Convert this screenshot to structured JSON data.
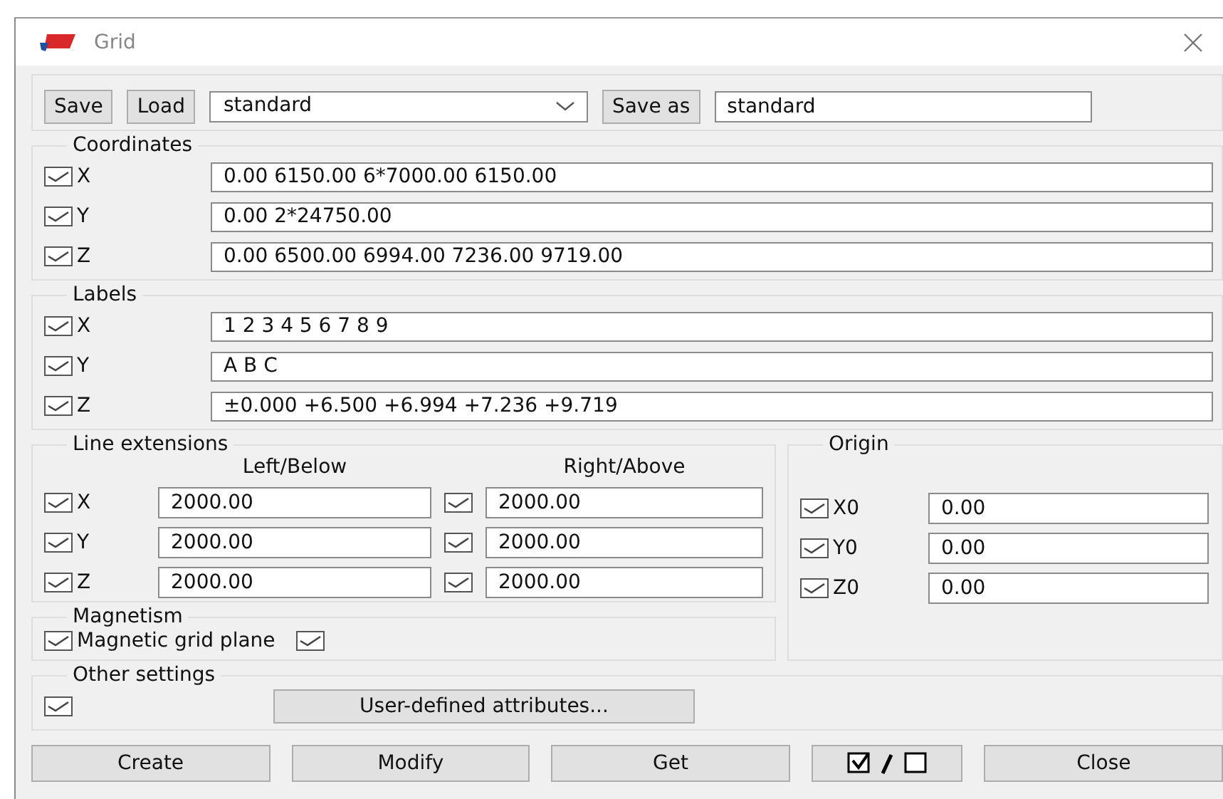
{
  "window": {
    "title": "Grid"
  },
  "toolbar": {
    "save": "Save",
    "load": "Load",
    "attribute_file": "standard",
    "save_as": "Save as",
    "save_as_name": "standard"
  },
  "coordinates": {
    "title": "Coordinates",
    "rows": [
      {
        "axis": "X",
        "checked": true,
        "value": "0.00 6150.00 6*7000.00 6150.00"
      },
      {
        "axis": "Y",
        "checked": true,
        "value": "0.00 2*24750.00"
      },
      {
        "axis": "Z",
        "checked": true,
        "value": "0.00 6500.00 6994.00 7236.00 9719.00"
      }
    ]
  },
  "labels": {
    "title": "Labels",
    "rows": [
      {
        "axis": "X",
        "checked": true,
        "value": "1 2 3 4 5 6 7 8 9"
      },
      {
        "axis": "Y",
        "checked": true,
        "value": "A B C"
      },
      {
        "axis": "Z",
        "checked": true,
        "value": "±0.000 +6.500 +6.994 +7.236 +9.719"
      }
    ]
  },
  "line_extensions": {
    "title": "Line extensions",
    "left_header": "Left/Below",
    "right_header": "Right/Above",
    "rows": [
      {
        "axis": "X",
        "left_checked": true,
        "left_value": "2000.00",
        "right_checked": true,
        "right_value": "2000.00"
      },
      {
        "axis": "Y",
        "left_checked": true,
        "left_value": "2000.00",
        "right_checked": true,
        "right_value": "2000.00"
      },
      {
        "axis": "Z",
        "left_checked": true,
        "left_value": "2000.00",
        "right_checked": true,
        "right_value": "2000.00"
      }
    ]
  },
  "origin": {
    "title": "Origin",
    "rows": [
      {
        "axis": "X0",
        "checked": true,
        "value": "0.00"
      },
      {
        "axis": "Y0",
        "checked": true,
        "value": "0.00"
      },
      {
        "axis": "Z0",
        "checked": true,
        "value": "0.00"
      }
    ]
  },
  "magnetism": {
    "title": "Magnetism",
    "label": "Magnetic grid plane",
    "checked": true,
    "second_checked": true
  },
  "other_settings": {
    "title": "Other settings",
    "checked": true,
    "button": "User-defined attributes..."
  },
  "buttons": [
    {
      "kind": "text",
      "label": "Create"
    },
    {
      "kind": "text",
      "label": "Modify"
    },
    {
      "kind": "text",
      "label": "Get"
    },
    {
      "kind": "select_toggle"
    },
    {
      "kind": "text",
      "label": "Close"
    }
  ]
}
